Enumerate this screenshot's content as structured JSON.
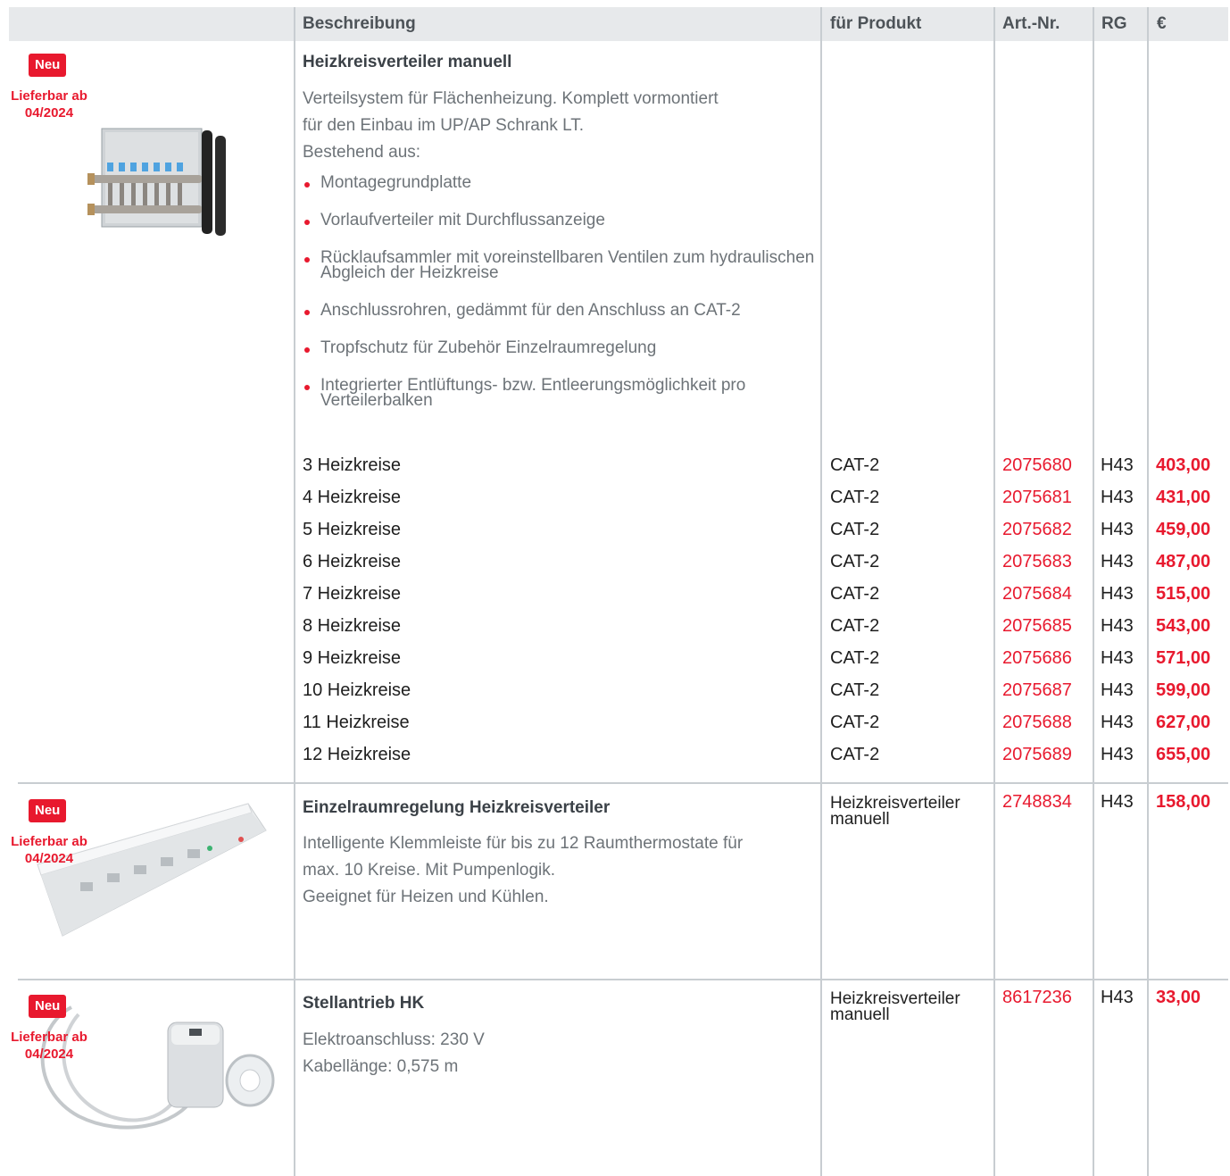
{
  "header": {
    "description": "Beschreibung",
    "product": "für Produkt",
    "article": "Art.-Nr.",
    "rg": "RG",
    "price": "€"
  },
  "badge_new": "Neu",
  "availability_line1": "Lieferbar ab",
  "availability_line2": "04/2024",
  "colors": {
    "accent": "#e8192e",
    "header_bg": "#e7e9eb",
    "grid": "#c8cdd1"
  },
  "item1": {
    "title": "Heizkreisverteiler manuell",
    "desc": [
      "Verteilsystem für Flächenheizung. Komplett vormontiert",
      "für den Einbau im UP/AP Schrank LT.",
      "Bestehend aus:"
    ],
    "bullets": [
      "Montagegrundplatte",
      "Vorlaufverteiler mit Durchflussanzeige",
      "Rücklaufsammler mit voreinstellbaren Ventilen zum hydraulischen Abgleich der Heizkreise",
      "Anschlussrohren, gedämmt für den Anschluss an CAT-2",
      "Tropfschutz für Zubehör Einzelraumregelung",
      "Integrierter Entlüftungs- bzw. Entleerungsmöglichkeit pro Verteilerbalken"
    ],
    "image": "heating-manifold-image",
    "rows": [
      {
        "desc": "3 Heizkreise",
        "product": "CAT-2",
        "art": "2075680",
        "rg": "H43",
        "price": "403,00"
      },
      {
        "desc": "4 Heizkreise",
        "product": "CAT-2",
        "art": "2075681",
        "rg": "H43",
        "price": "431,00"
      },
      {
        "desc": "5 Heizkreise",
        "product": "CAT-2",
        "art": "2075682",
        "rg": "H43",
        "price": "459,00"
      },
      {
        "desc": "6 Heizkreise",
        "product": "CAT-2",
        "art": "2075683",
        "rg": "H43",
        "price": "487,00"
      },
      {
        "desc": "7 Heizkreise",
        "product": "CAT-2",
        "art": "2075684",
        "rg": "H43",
        "price": "515,00"
      },
      {
        "desc": "8 Heizkreise",
        "product": "CAT-2",
        "art": "2075685",
        "rg": "H43",
        "price": "543,00"
      },
      {
        "desc": "9 Heizkreise",
        "product": "CAT-2",
        "art": "2075686",
        "rg": "H43",
        "price": "571,00"
      },
      {
        "desc": "10 Heizkreise",
        "product": "CAT-2",
        "art": "2075687",
        "rg": "H43",
        "price": "599,00"
      },
      {
        "desc": "11 Heizkreise",
        "product": "CAT-2",
        "art": "2075688",
        "rg": "H43",
        "price": "627,00"
      },
      {
        "desc": "12 Heizkreise",
        "product": "CAT-2",
        "art": "2075689",
        "rg": "H43",
        "price": "655,00"
      }
    ]
  },
  "item2": {
    "title": "Einzelraumregelung Heizkreisverteiler",
    "desc": [
      "Intelligente Klemmleiste für bis zu 12 Raumthermostate für",
      "max. 10 Kreise. Mit Pumpenlogik.",
      "Geeignet für Heizen und Kühlen."
    ],
    "product_line1": "Heizkreisverteiler",
    "product_line2": "manuell",
    "art": "2748834",
    "rg": "H43",
    "price": "158,00",
    "image": "terminal-strip-image"
  },
  "item3": {
    "title": "Stellantrieb HK",
    "desc": [
      "Elektroanschluss: 230 V",
      "Kabellänge: 0,575 m"
    ],
    "product_line1": "Heizkreisverteiler",
    "product_line2": "manuell",
    "art": "8617236",
    "rg": "H43",
    "price": "33,00",
    "image": "actuator-image"
  }
}
